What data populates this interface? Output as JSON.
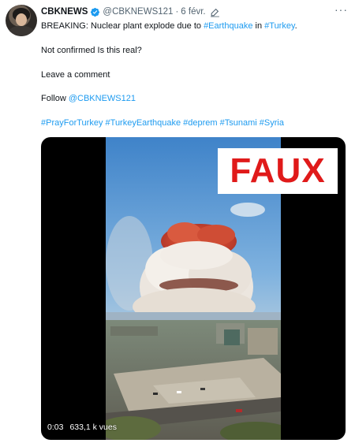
{
  "tweet": {
    "author_name": "CBKNEWS",
    "handle": "@CBKNEWS121",
    "separator": "·",
    "date": "6 févr.",
    "more": "···",
    "lines": {
      "line1_prefix": "BREAKING: Nuclear plant explode due to ",
      "line1_tag1": "#Earthquake",
      "line1_mid": " in ",
      "line1_tag2": "#Turkey",
      "line1_suffix": ".",
      "line2": "Not confirmed Is this real?",
      "line3": "Leave a comment",
      "line4_prefix": "Follow ",
      "line4_mention": "@CBKNEWS121",
      "hashtags": [
        "#PrayForTurkey",
        "#TurkeyEarthquake",
        "#deprem",
        "#Tsunami",
        "#Syria"
      ]
    },
    "media": {
      "overlay_label": "FAUX",
      "duration": "0:03",
      "views": "633,1 k vues"
    },
    "colors": {
      "link": "#1d9bf0",
      "verified": "#1d9bf0",
      "overlay_text": "#e01a1a",
      "muted": "#536471"
    },
    "icons": [
      "verified-badge-icon",
      "edit-pencil-icon",
      "more-options-icon"
    ]
  }
}
